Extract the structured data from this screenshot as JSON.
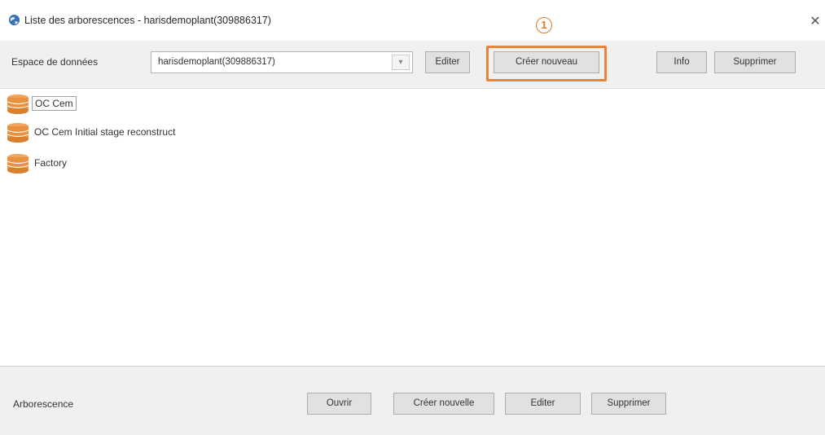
{
  "window": {
    "title": "Liste des arborescences - harisdemoplant(309886317)",
    "close_glyph": "✕",
    "icon": "globe-icon"
  },
  "toolbar": {
    "data_space_label": "Espace de données",
    "data_space_value": "harisdemoplant(309886317)",
    "edit_label": "Editer",
    "create_new_label": "Créer nouveau",
    "info_label": "Info",
    "delete_label": "Supprimer"
  },
  "annotation": {
    "marker": "1",
    "color": "#e8833a"
  },
  "tree": {
    "items": [
      {
        "label": "OC Cem",
        "icon": "database-icon",
        "selected": true
      },
      {
        "label": "OC Cem Initial stage reconstruct",
        "icon": "database-icon"
      },
      {
        "label": "Factory",
        "icon": "database-icon"
      }
    ]
  },
  "footer": {
    "label": "Arborescence",
    "open_label": "Ouvrir",
    "create_new_label": "Créer nouvelle",
    "edit_label": "Editer",
    "delete_label": "Supprimer"
  },
  "colors": {
    "db_icon": "#e8913f",
    "highlight": "#e8833a"
  }
}
